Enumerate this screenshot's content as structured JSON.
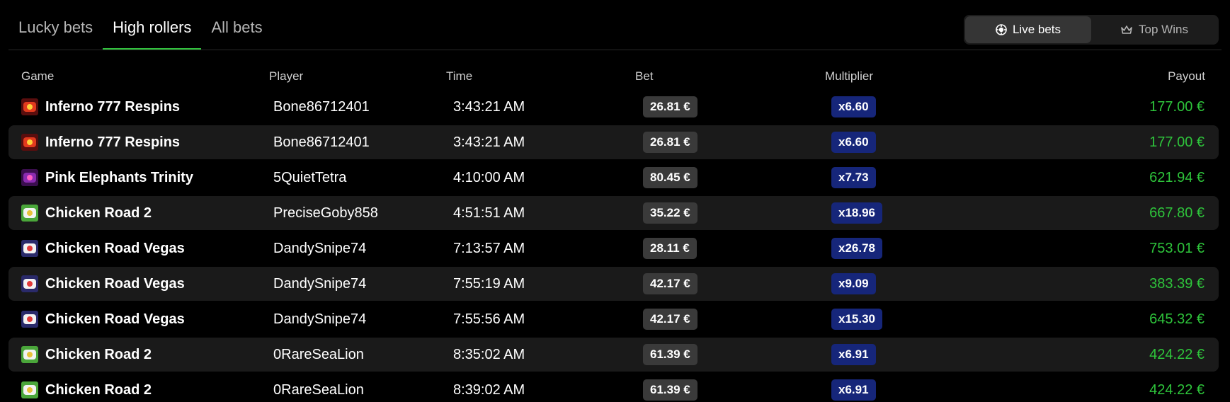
{
  "tabs": [
    {
      "label": "Lucky bets",
      "active": false
    },
    {
      "label": "High rollers",
      "active": true
    },
    {
      "label": "All bets",
      "active": false
    }
  ],
  "toggle": {
    "live_label": "Live bets",
    "live_icon": "chip-icon",
    "top_label": "Top Wins",
    "top_icon": "crown-icon",
    "active": "live"
  },
  "columns": {
    "game": "Game",
    "player": "Player",
    "time": "Time",
    "bet": "Bet",
    "multiplier": "Multiplier",
    "payout": "Payout"
  },
  "colors": {
    "background": "#000000",
    "row_alt": "#1a1a1a",
    "accent_green": "#31c23d",
    "payout_green": "#2ec43b",
    "bet_pill": "#3a3a3a",
    "multiplier_pill": "#16267a"
  },
  "rows": [
    {
      "game": "Inferno 777 Respins",
      "icon": "inferno-game-icon",
      "player": "Bone86712401",
      "time": "3:43:21 AM",
      "bet": "26.81 €",
      "multiplier": "x6.60",
      "payout": "177.00 €"
    },
    {
      "game": "Inferno 777 Respins",
      "icon": "inferno-game-icon",
      "player": "Bone86712401",
      "time": "3:43:21 AM",
      "bet": "26.81 €",
      "multiplier": "x6.60",
      "payout": "177.00 €"
    },
    {
      "game": "Pink Elephants Trinity",
      "icon": "pink-elephants-game-icon",
      "player": "5QuietTetra",
      "time": "4:10:00 AM",
      "bet": "80.45 €",
      "multiplier": "x7.73",
      "payout": "621.94 €"
    },
    {
      "game": "Chicken Road 2",
      "icon": "chicken-road-2-game-icon",
      "player": "PreciseGoby858",
      "time": "4:51:51 AM",
      "bet": "35.22 €",
      "multiplier": "x18.96",
      "payout": "667.80 €"
    },
    {
      "game": "Chicken Road Vegas",
      "icon": "chicken-road-vegas-game-icon",
      "player": "DandySnipe74",
      "time": "7:13:57 AM",
      "bet": "28.11 €",
      "multiplier": "x26.78",
      "payout": "753.01 €"
    },
    {
      "game": "Chicken Road Vegas",
      "icon": "chicken-road-vegas-game-icon",
      "player": "DandySnipe74",
      "time": "7:55:19 AM",
      "bet": "42.17 €",
      "multiplier": "x9.09",
      "payout": "383.39 €"
    },
    {
      "game": "Chicken Road Vegas",
      "icon": "chicken-road-vegas-game-icon",
      "player": "DandySnipe74",
      "time": "7:55:56 AM",
      "bet": "42.17 €",
      "multiplier": "x15.30",
      "payout": "645.32 €"
    },
    {
      "game": "Chicken Road 2",
      "icon": "chicken-road-2-game-icon",
      "player": "0RareSeaLion",
      "time": "8:35:02 AM",
      "bet": "61.39 €",
      "multiplier": "x6.91",
      "payout": "424.22 €"
    },
    {
      "game": "Chicken Road 2",
      "icon": "chicken-road-2-game-icon",
      "player": "0RareSeaLion",
      "time": "8:39:02 AM",
      "bet": "61.39 €",
      "multiplier": "x6.91",
      "payout": "424.22 €"
    }
  ]
}
